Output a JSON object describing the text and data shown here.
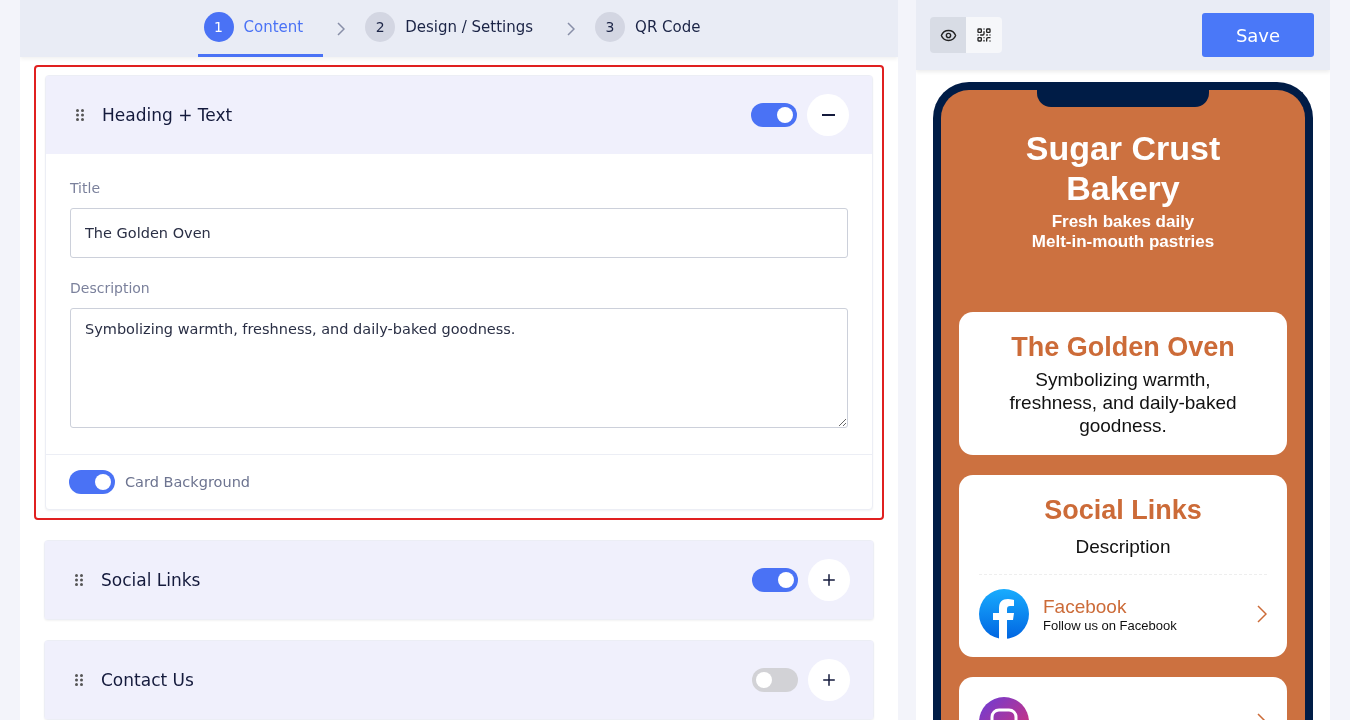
{
  "steps": [
    {
      "number": "1",
      "label": "Content",
      "selected": true
    },
    {
      "number": "2",
      "label": "Design / Settings",
      "selected": false
    },
    {
      "number": "3",
      "label": "QR Code",
      "selected": false
    }
  ],
  "sections": [
    {
      "title": "Heading + Text",
      "on": true,
      "expanded": true,
      "highlighted": true,
      "fields": [
        {
          "kind": "input",
          "label": "Title",
          "value": "The Golden Oven"
        },
        {
          "kind": "textarea",
          "label": "Description",
          "value": "Symbolizing warmth, freshness, and daily-baked goodness."
        }
      ],
      "card_background": {
        "label": "Card Background",
        "on": true
      }
    },
    {
      "title": "Social Links",
      "on": true,
      "expanded": false,
      "highlighted": false
    },
    {
      "title": "Contact Us",
      "on": false,
      "expanded": false,
      "highlighted": false
    }
  ],
  "view_modes": [
    {
      "kind": "preview",
      "selected": true
    },
    {
      "kind": "qr",
      "selected": false
    }
  ],
  "save_button": "Save",
  "preview": {
    "title": "Sugar Crust Bakery",
    "subtitle_lines": [
      "Fresh bakes daily",
      "Melt-in-mouth pastries"
    ],
    "cards": [
      {
        "kind": "text",
        "title": "The Golden Oven",
        "description": "Symbolizing warmth, freshness, and daily-baked goodness."
      },
      {
        "kind": "social",
        "title": "Social Links",
        "description": "Description",
        "links": [
          {
            "kind": "facebook",
            "name": "Facebook",
            "caption": "Follow us on Facebook"
          }
        ]
      },
      {
        "kind": "partial",
        "links": [
          {
            "kind": "instagram"
          }
        ]
      }
    ]
  }
}
